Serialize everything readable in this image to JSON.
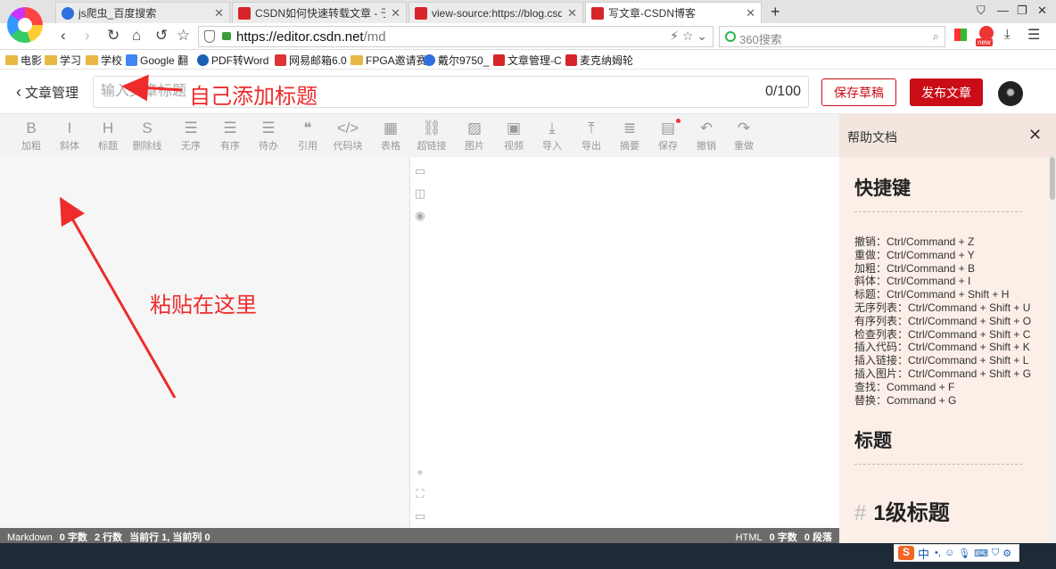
{
  "browser": {
    "tabs": [
      {
        "label": "js爬虫_百度搜索",
        "icon": "baidu-icon",
        "active": false
      },
      {
        "label": "CSDN如何快速转载文章 - 于子",
        "icon": "csdn-icon",
        "active": false
      },
      {
        "label": "view-source:https://blog.csd",
        "icon": "csdn-icon",
        "active": false
      },
      {
        "label": "写文章-CSDN博客",
        "icon": "csdn-icon",
        "active": true
      }
    ],
    "url_host": "https://editor.csdn.net",
    "url_path": "/md",
    "search_placeholder": "360搜索",
    "new_badge": "new",
    "bookmarks": [
      "电影",
      "学习",
      "学校",
      "Google 翻",
      "PDF转Word",
      "网易邮箱6.0",
      "FPGA邀请赛",
      "戴尔9750_",
      "文章管理-C",
      "麦克纳姆轮"
    ]
  },
  "editor": {
    "back_label": "文章管理",
    "title_placeholder": "输入文章标题",
    "title_counter": "0/100",
    "save_draft_label": "保存草稿",
    "publish_label": "发布文章",
    "toolbar": [
      {
        "glyph": "B",
        "label": "加粗",
        "icon": "bold-icon"
      },
      {
        "glyph": "I",
        "label": "斜体",
        "icon": "italic-icon"
      },
      {
        "glyph": "H",
        "label": "标题",
        "icon": "heading-icon"
      },
      {
        "glyph": "S",
        "label": "删除线",
        "icon": "strikethrough-icon"
      },
      {
        "glyph": "☰",
        "label": "无序",
        "icon": "unordered-list-icon"
      },
      {
        "glyph": "☰",
        "label": "有序",
        "icon": "ordered-list-icon"
      },
      {
        "glyph": "☰",
        "label": "待办",
        "icon": "todo-list-icon"
      },
      {
        "glyph": "❝",
        "label": "引用",
        "icon": "quote-icon"
      },
      {
        "glyph": "</>",
        "label": "代码块",
        "icon": "code-block-icon"
      },
      {
        "glyph": "▦",
        "label": "表格",
        "icon": "table-icon"
      },
      {
        "glyph": "⛓",
        "label": "超链接",
        "icon": "link-icon"
      },
      {
        "glyph": "▨",
        "label": "图片",
        "icon": "image-icon"
      },
      {
        "glyph": "▣",
        "label": "视频",
        "icon": "video-icon"
      },
      {
        "glyph": "⤓",
        "label": "导入",
        "icon": "import-icon"
      },
      {
        "glyph": "⤒",
        "label": "导出",
        "icon": "export-icon"
      },
      {
        "glyph": "≣",
        "label": "摘要",
        "icon": "summary-icon"
      },
      {
        "glyph": "▤",
        "label": "保存",
        "icon": "save-icon"
      },
      {
        "glyph": "↶",
        "label": "撤销",
        "icon": "undo-icon"
      },
      {
        "glyph": "↷",
        "label": "重做",
        "icon": "redo-icon"
      }
    ],
    "status_left": {
      "mode": "Markdown",
      "chars": "0 字数",
      "lines": "2 行数",
      "cursor": "当前行 1, 当前列 0"
    },
    "status_right": {
      "mode": "HTML",
      "chars": "0 字数",
      "paragraphs": "0 段落"
    }
  },
  "help": {
    "title": "帮助文档",
    "section1": "快捷键",
    "rule": "--------------------------------",
    "shortcuts": [
      "撤销：Ctrl/Command + Z",
      "重做：Ctrl/Command + Y",
      "加粗：Ctrl/Command + B",
      "斜体：Ctrl/Command + I",
      "标题：Ctrl/Command + Shift + H",
      "无序列表：Ctrl/Command + Shift + U",
      "有序列表：Ctrl/Command + Shift + O",
      "检查列表：Ctrl/Command + Shift + C",
      "插入代码：Ctrl/Command + Shift + K",
      "插入链接：Ctrl/Command + Shift + L",
      "插入图片：Ctrl/Command + Shift + G",
      "查找：Command + F",
      "替换：Command + G"
    ],
    "section2": "标题",
    "h1_hash": "#",
    "h1_demo": "1级标题"
  },
  "annotations": {
    "title_note": "自己添加标题",
    "paste_note": "粘贴在这里"
  },
  "taskbar": {
    "ime_logo": "S",
    "ime_lang": "中"
  },
  "colors": {
    "brand_red": "#ca0c16",
    "annotation_red": "#ee2c2c",
    "help_bg": "#fbefe7"
  }
}
